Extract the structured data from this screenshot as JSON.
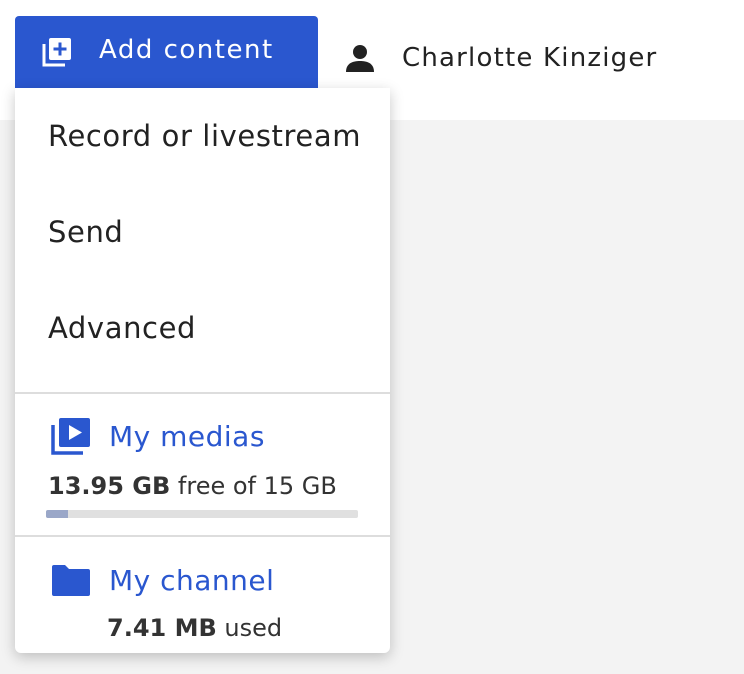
{
  "header": {
    "add_button_label": "Add content",
    "add_button_icon": "add-library-icon",
    "user_icon": "person-icon",
    "user_name": "Charlotte Kinziger",
    "accent_color": "#2a57cf"
  },
  "menu": {
    "items": [
      {
        "label": "Record or livestream"
      },
      {
        "label": "Send"
      },
      {
        "label": "Advanced"
      }
    ],
    "medias": {
      "icon": "video-library-icon",
      "label": "My medias",
      "free_amount": "13.95 GB",
      "free_text": "free of 15 GB",
      "used_fraction": 0.07
    },
    "channel": {
      "icon": "folder-icon",
      "label": "My channel",
      "used_amount": "7.41 MB",
      "used_text": "used"
    }
  }
}
